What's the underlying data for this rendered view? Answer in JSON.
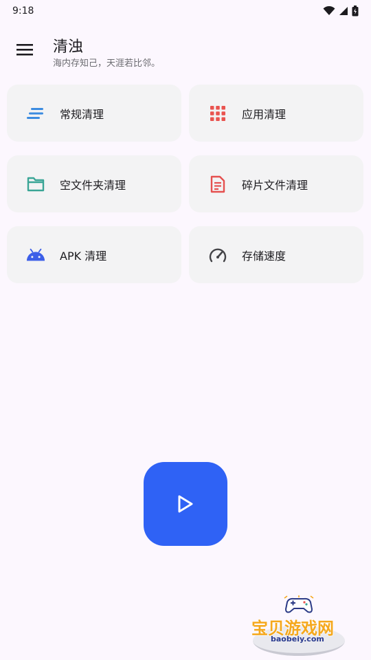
{
  "status_bar": {
    "time": "9:18"
  },
  "app_bar": {
    "title": "清浊",
    "subtitle": "海内存知己，天涯若比邻。"
  },
  "cards": [
    {
      "label": "常规清理",
      "icon": "lines-icon",
      "color": "#3b8be0"
    },
    {
      "label": "应用清理",
      "icon": "apps-grid-icon",
      "color": "#e9534f"
    },
    {
      "label": "空文件夹清理",
      "icon": "folder-icon",
      "color": "#3aa596"
    },
    {
      "label": "碎片文件清理",
      "icon": "document-icon",
      "color": "#e5504f"
    },
    {
      "label": "APK 清理",
      "icon": "android-icon",
      "color": "#3d5fe8"
    },
    {
      "label": "存储速度",
      "icon": "speedometer-icon",
      "color": "#444448"
    }
  ],
  "fab": {
    "icon": "play-icon",
    "color": "#2f62f5"
  },
  "watermark": {
    "text": "宝贝游戏网",
    "url": "baobeiy.com"
  }
}
